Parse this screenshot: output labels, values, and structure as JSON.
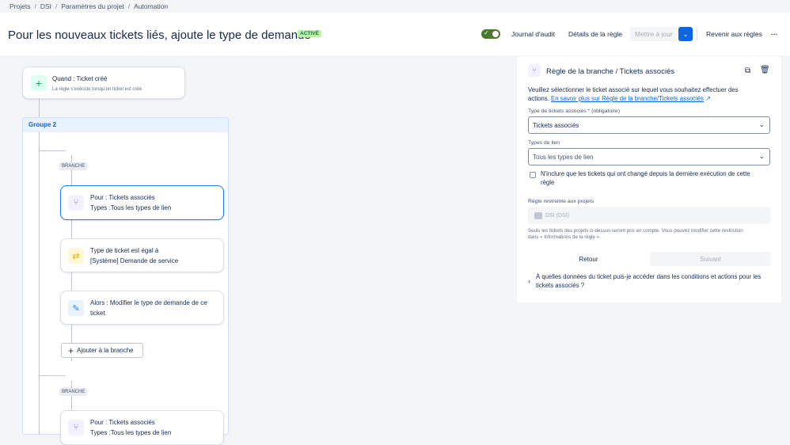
{
  "breadcrumb": [
    "Projets",
    "DSI",
    "Paramètres du projet",
    "Automation"
  ],
  "header": {
    "title": "Pour les nouveaux tickets liés, ajoute le type de demande",
    "status_badge": "ACTIVÉ",
    "audit_label": "Journal d'audit",
    "details_label": "Détails de la règle",
    "update_label": "Mettre à jour",
    "back_rules_label": "Revenir aux règles",
    "more_label": "···"
  },
  "flow": {
    "trigger": {
      "title": "Quand : Ticket créé",
      "subtitle": "La règle s'exécute lorsqu'un ticket est créé."
    },
    "group_label": "Groupe 2",
    "branch_label": "BRANCHE",
    "branch1": {
      "line1": "Pour : Tickets associés",
      "line2": "Types :Tous les types de lien"
    },
    "condition": {
      "line1": "Type de ticket est égal à",
      "line2": "[Système] Demande de service"
    },
    "action": {
      "line1": "Alors : Modifier le type de demande de ce",
      "line2": "ticket"
    },
    "add_branch_label": "Ajouter à la branche",
    "branch2_label": "BRANCHE",
    "branch2": {
      "line1": "Pour : Tickets associés",
      "line2": "Types :Tous les types de lien"
    }
  },
  "panel": {
    "title": "Règle de la branche / Tickets associés",
    "intro": "Veuillez sélectionner le ticket associé sur lequel vous souhaitez effectuer des",
    "intro2": "actions.",
    "learn_link": "En savoir plus sur Règle de la branche/Tickets associés",
    "linked_type_label": "Type de tickets associés * (obligatoire)",
    "linked_type_value": "Tickets associés",
    "link_types_label": "Types de lien",
    "link_types_value": "Tous les types de lien",
    "only_changed_label": "N'inclure que les tickets qui ont changé depuis la dernière exécution de cette",
    "only_changed_label2": "règle",
    "restricted_label": "Règle restreinte aux projets",
    "project_value": "DSI (DSI)",
    "note": "Seuls les tickets des projets ci-dessus seront pris en compte. Vous pouvez modifier cette restriction",
    "note2": "dans « Informations de la règle ».",
    "back_button": "Retour",
    "next_button": "Suivant",
    "faq": "À quelles données du ticket puis-je accéder dans les conditions et actions pour les",
    "faq2": "tickets associés ?"
  },
  "colors": {
    "accent": "#0c66e4",
    "selected_border": "#1d7afc",
    "toggle_on": "#4a7a2c"
  }
}
